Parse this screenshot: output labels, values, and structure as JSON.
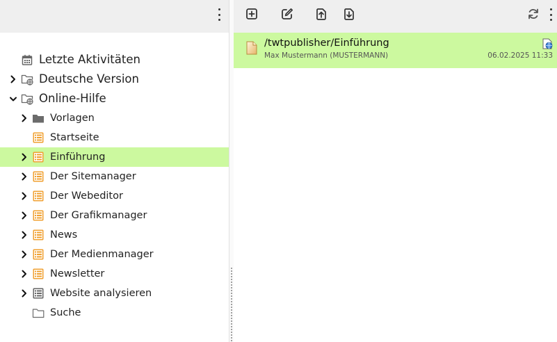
{
  "left_panel": {
    "tree": [
      {
        "label": "Letzte Aktivitäten",
        "icon": "calendar-icon",
        "level": 0,
        "expander": "none",
        "selected": false
      },
      {
        "label": "Deutsche Version",
        "icon": "globe-folder-icon",
        "level": 0,
        "expander": "collapsed",
        "selected": false
      },
      {
        "label": "Online-Hilfe",
        "icon": "globe-folder-icon",
        "level": 0,
        "expander": "expanded",
        "selected": false
      },
      {
        "label": "Vorlagen",
        "icon": "folder-icon",
        "level": 1,
        "expander": "collapsed",
        "selected": false
      },
      {
        "label": "Startseite",
        "icon": "page-list-icon",
        "level": 1,
        "expander": "none",
        "selected": false
      },
      {
        "label": "Einführung",
        "icon": "page-list-icon",
        "level": 1,
        "expander": "collapsed",
        "selected": true
      },
      {
        "label": "Der Sitemanager",
        "icon": "page-list-icon",
        "level": 1,
        "expander": "collapsed",
        "selected": false
      },
      {
        "label": "Der Webeditor",
        "icon": "page-list-icon",
        "level": 1,
        "expander": "collapsed",
        "selected": false
      },
      {
        "label": "Der Grafikmanager",
        "icon": "page-list-icon",
        "level": 1,
        "expander": "collapsed",
        "selected": false
      },
      {
        "label": "News",
        "icon": "page-list-icon",
        "level": 1,
        "expander": "collapsed",
        "selected": false
      },
      {
        "label": "Der Medienmanager",
        "icon": "page-list-icon",
        "level": 1,
        "expander": "collapsed",
        "selected": false
      },
      {
        "label": "Newsletter",
        "icon": "page-list-icon",
        "level": 1,
        "expander": "collapsed",
        "selected": false
      },
      {
        "label": "Website analysieren",
        "icon": "gray-list-icon",
        "level": 1,
        "expander": "collapsed",
        "selected": false
      },
      {
        "label": "Suche",
        "icon": "folder-outline-icon",
        "level": 1,
        "expander": "none",
        "selected": false
      }
    ]
  },
  "right_panel": {
    "toolbar_icons": [
      "add-page-icon",
      "edit-icon",
      "upload-icon",
      "download-icon",
      "refresh-icon",
      "more-menu-icon"
    ],
    "document": {
      "path": "/twtpublisher/Einführung",
      "user": "Max Mustermann (MUSTERMANN)",
      "date": "06.02.2025 11:33",
      "icon": "document-icon",
      "status_icon": "published-web-icon"
    }
  },
  "colors": {
    "selection": "#ccf99f",
    "toolbar": "#efefef",
    "page_icon": "#f0a030",
    "folder": "#6b6b6b"
  }
}
